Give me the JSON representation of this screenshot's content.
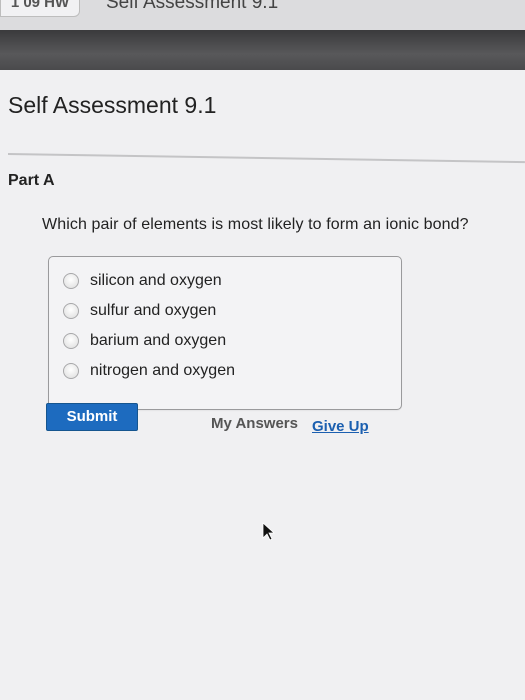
{
  "browser": {
    "left_tab_label": "1 09 HW",
    "active_tab_title": "Self Assessment 9.1"
  },
  "page": {
    "title": "Self Assessment 9.1",
    "part_label": "Part A",
    "question": "Which pair of elements is most likely to form an ionic bond?",
    "choices": [
      {
        "label": "silicon and oxygen"
      },
      {
        "label": "sulfur and oxygen"
      },
      {
        "label": "barium and oxygen"
      },
      {
        "label": "nitrogen and oxygen"
      }
    ],
    "buttons": {
      "submit_label": "Submit",
      "my_answers_label": "My Answers",
      "give_up_label": "Give Up"
    }
  },
  "icons": {
    "cursor": "mouse-pointer-icon",
    "radio": "radio-unselected-icon"
  },
  "colors": {
    "submit_bg": "#1d6bbf",
    "link": "#1b5fb0",
    "dark_toolbar": "#4a4a4c"
  }
}
